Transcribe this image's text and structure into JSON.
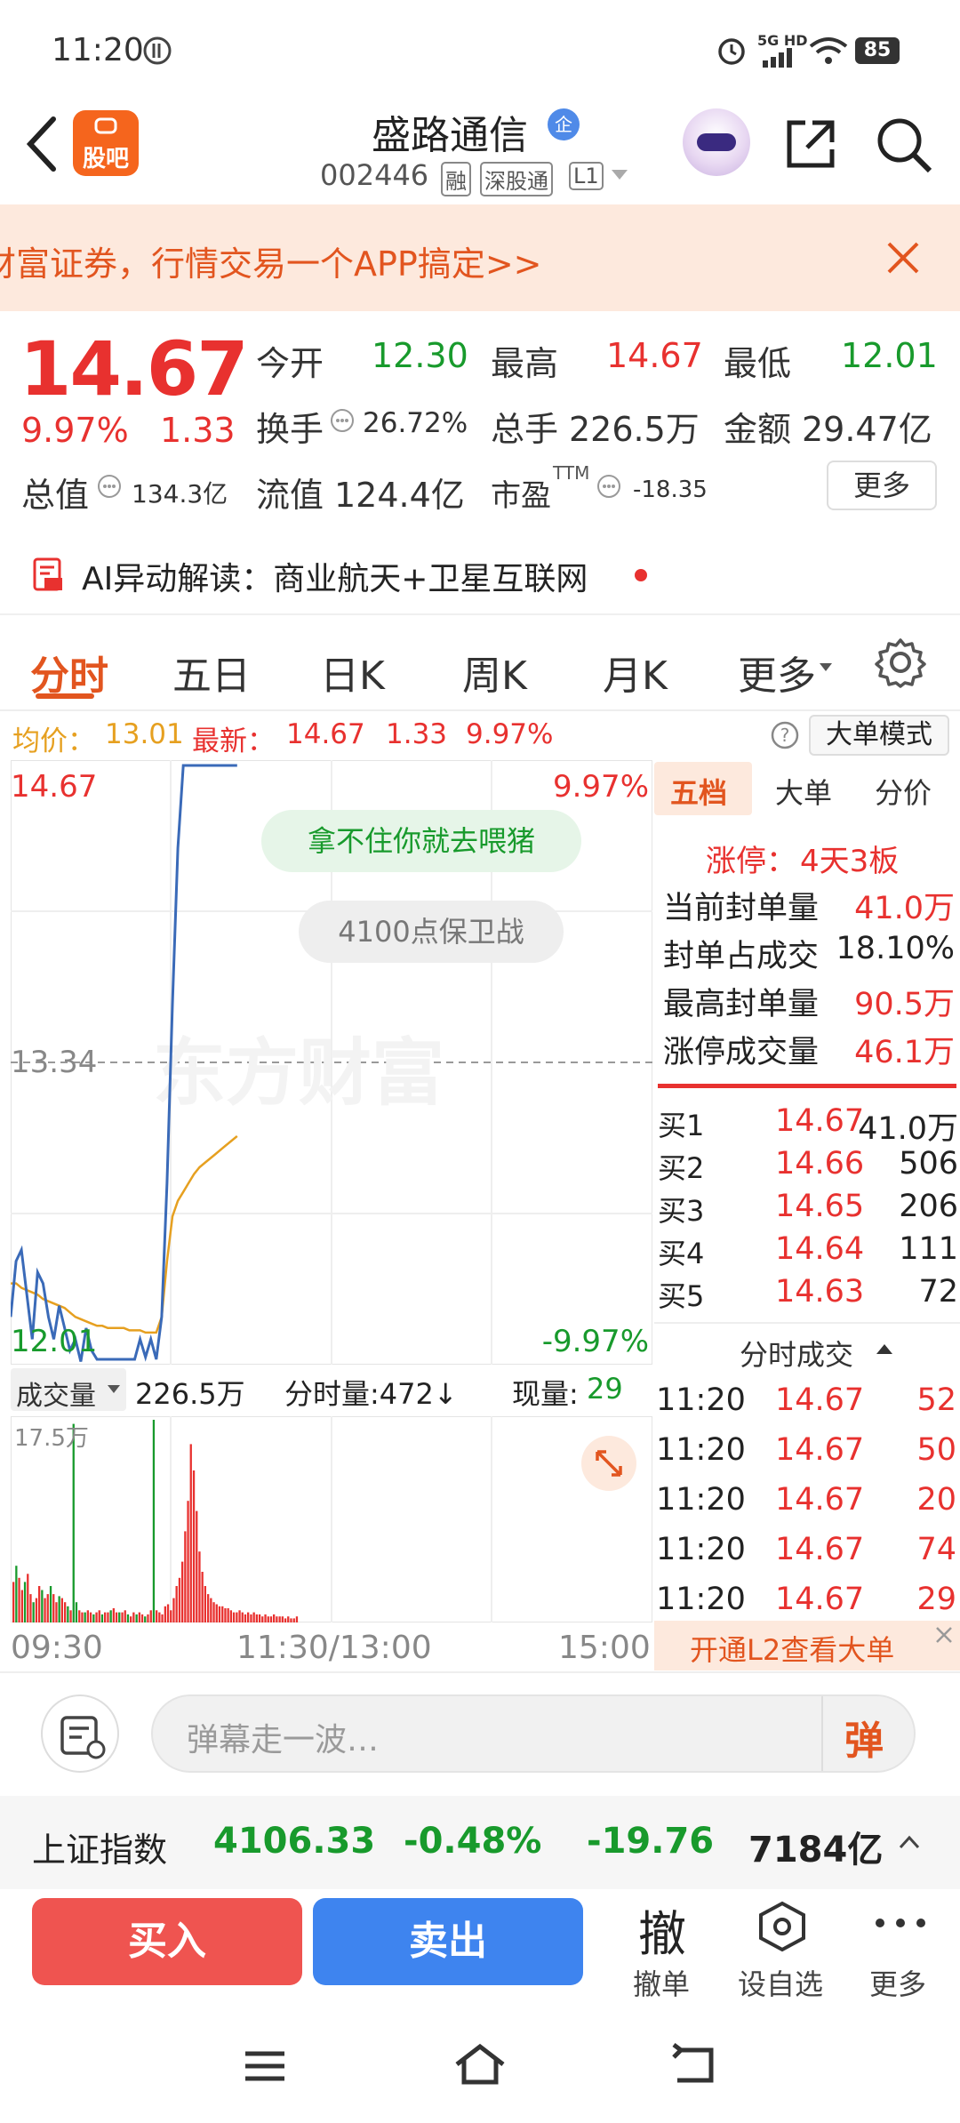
{
  "status_bar": {
    "time": "11:20",
    "signal": "5G HD",
    "battery": "85"
  },
  "nav": {
    "logo_text": "股吧",
    "stock_name": "盛路通信",
    "badge": "企",
    "code": "002446",
    "tags": [
      "融",
      "深股通",
      "L1"
    ]
  },
  "banner": {
    "text": "财富证券，行情交易一个APP搞定>>"
  },
  "quote": {
    "price": "14.67",
    "change_pct": "9.97%",
    "change": "1.33",
    "open_label": "今开",
    "open": "12.30",
    "high_label": "最高",
    "high": "14.67",
    "low_label": "最低",
    "low": "12.01",
    "turnover_label": "换手",
    "turnover": "26.72%",
    "volume_label": "总手",
    "volume": "226.5万",
    "amount_label": "金额",
    "amount": "29.47亿",
    "mktcap_label": "总值",
    "mktcap": "134.3亿",
    "float_label": "流值",
    "float": "124.4亿",
    "pe_label": "市盈",
    "pe_sup": "TTM",
    "pe": "-18.35",
    "more_button": "更多"
  },
  "ai_bar": {
    "text": "AI异动解读：商业航天+卫星互联网"
  },
  "tabs": [
    "分时",
    "五日",
    "日K",
    "周K",
    "月K",
    "更多"
  ],
  "infobar": {
    "avg_label": "均价：",
    "avg": "13.01",
    "latest_label": "最新：",
    "latest": "14.67",
    "change": "1.33",
    "change_pct": "9.97%",
    "mode_button": "大单模式"
  },
  "chart_data": {
    "type": "line",
    "title": "",
    "y_top": "14.67",
    "y_mid": "13.34",
    "y_bottom": "12.01",
    "pct_top": "9.97%",
    "pct_bottom": "-9.97%",
    "x_labels": [
      "09:30",
      "11:30/13:00",
      "15:00"
    ],
    "ylim": [
      12.01,
      14.67
    ],
    "price_series": [
      12.2,
      12.45,
      12.5,
      12.3,
      12.1,
      12.4,
      12.35,
      12.2,
      12.1,
      12.25,
      12.15,
      12.05,
      12.1,
      12.0,
      12.15,
      12.05,
      12.01,
      12.01,
      12.01,
      12.01,
      12.01,
      12.01,
      12.01,
      12.01,
      12.1,
      12.02,
      12.1,
      12.01,
      12.2,
      12.8,
      13.6,
      14.3,
      14.67,
      14.67,
      14.67,
      14.67,
      14.67,
      14.67,
      14.67,
      14.67,
      14.67,
      14.67,
      14.67
    ],
    "avg_series": [
      12.35,
      12.35,
      12.33,
      12.32,
      12.31,
      12.3,
      12.28,
      12.27,
      12.26,
      12.25,
      12.24,
      12.22,
      12.2,
      12.19,
      12.18,
      12.17,
      12.16,
      12.16,
      12.15,
      12.15,
      12.15,
      12.15,
      12.14,
      12.14,
      12.14,
      12.13,
      12.13,
      12.13,
      12.2,
      12.45,
      12.65,
      12.72,
      12.76,
      12.8,
      12.84,
      12.87,
      12.89,
      12.91,
      12.93,
      12.95,
      12.97,
      12.99,
      13.01
    ],
    "series_len_full": 120,
    "overlays": [
      "拿不住你就去喂猪",
      "4100点保卫战"
    ],
    "watermark": "东方财富"
  },
  "volume_bar": {
    "label": "成交量",
    "total": "226.5万",
    "minute_label": "分时量:472↓",
    "now_label": "现量:",
    "now": "29",
    "max_tick": "17.5万"
  },
  "volume_data": [
    0.2,
    0.28,
    0.22,
    0.16,
    0.2,
    0.24,
    0.14,
    0.1,
    0.12,
    0.18,
    0.16,
    0.12,
    0.14,
    0.18,
    0.14,
    0.1,
    0.13,
    0.12,
    0.1,
    0.08,
    0.06,
    0.98,
    0.1,
    0.06,
    0.05,
    0.05,
    0.06,
    0.05,
    0.04,
    0.05,
    0.06,
    0.04,
    0.05,
    0.05,
    0.06,
    0.07,
    0.05,
    0.05,
    0.05,
    0.06,
    0.04,
    0.03,
    0.05,
    0.04,
    0.05,
    0.04,
    0.03,
    0.04,
    0.06,
    1.0,
    0.06,
    0.05,
    0.04,
    0.08,
    0.09,
    0.06,
    0.12,
    0.18,
    0.22,
    0.3,
    0.45,
    0.6,
    0.88,
    0.75,
    0.55,
    0.35,
    0.25,
    0.18,
    0.14,
    0.12,
    0.1,
    0.09,
    0.08,
    0.08,
    0.07,
    0.07,
    0.06,
    0.05,
    0.05,
    0.06,
    0.05,
    0.04,
    0.05,
    0.04,
    0.05,
    0.04,
    0.04,
    0.03,
    0.04,
    0.03,
    0.03,
    0.04,
    0.03,
    0.03,
    0.03,
    0.02,
    0.03,
    0.02,
    0.02,
    0.03
  ],
  "book": {
    "tabs": [
      "五档",
      "大单",
      "分价"
    ],
    "limit_label": "涨停：",
    "limit_value": "4天3板",
    "stats": [
      {
        "label": "当前封单量",
        "value": "41.0万"
      },
      {
        "label": "封单占成交",
        "value": "18.10%"
      },
      {
        "label": "最高封单量",
        "value": "90.5万"
      },
      {
        "label": "涨停成交量",
        "value": "46.1万"
      }
    ],
    "bids": [
      {
        "label": "买1",
        "price": "14.67",
        "qty": "41.0万"
      },
      {
        "label": "买2",
        "price": "14.66",
        "qty": "506"
      },
      {
        "label": "买3",
        "price": "14.65",
        "qty": "206"
      },
      {
        "label": "买4",
        "price": "14.64",
        "qty": "111"
      },
      {
        "label": "买5",
        "price": "14.63",
        "qty": "72"
      }
    ],
    "trades_title": "分时成交",
    "trades": [
      {
        "time": "11:20",
        "price": "14.67",
        "qty": "52"
      },
      {
        "time": "11:20",
        "price": "14.67",
        "qty": "50"
      },
      {
        "time": "11:20",
        "price": "14.67",
        "qty": "20"
      },
      {
        "time": "11:20",
        "price": "14.67",
        "qty": "74"
      },
      {
        "time": "11:20",
        "price": "14.67",
        "qty": "29"
      }
    ],
    "l2_banner": "开通L2查看大单"
  },
  "comment": {
    "placeholder": "弹幕走一波…",
    "danmu_icon": "弹"
  },
  "index": {
    "name": "上证指数",
    "value": "4106.33",
    "pct": "-0.48%",
    "change": "-19.76",
    "amount": "7184亿"
  },
  "actions": {
    "buy": "买入",
    "sell": "卖出",
    "cancel_big": "撤",
    "cancel": "撤单",
    "watch": "设自选",
    "more": "更多"
  },
  "colors": {
    "red": "#e8312f",
    "green": "#189a2c",
    "price_line": "#3a6ab8",
    "avg_line": "#e6a020"
  }
}
